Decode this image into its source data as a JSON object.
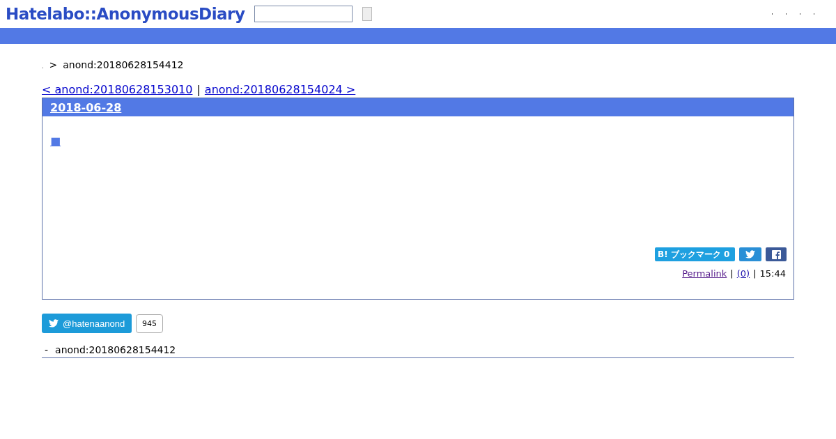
{
  "header": {
    "logo": "Hatelabo::AnonymousDiary",
    "search": {
      "kind": "field"
    }
  },
  "breadcrumb": {
    "root": ".",
    "separator": ">",
    "current": "anond:20180628154412"
  },
  "pager": {
    "prev": "< anond:20180628153010",
    "separator": "|",
    "next": "anond:20180628154024 >"
  },
  "entry": {
    "date": "2018-06-28",
    "title_mark": "■",
    "share": {
      "bookmark": "B! ブックマーク 0"
    },
    "footer": {
      "permalink": "Permalink",
      "sep1": "|",
      "comments": "(0)",
      "sep2": "|",
      "time": "15:44"
    }
  },
  "follow": {
    "handle": "@hatenaanond",
    "count": "945"
  },
  "related": [
    {
      "marker": "-",
      "title": "anond:20180628154412"
    }
  ]
}
